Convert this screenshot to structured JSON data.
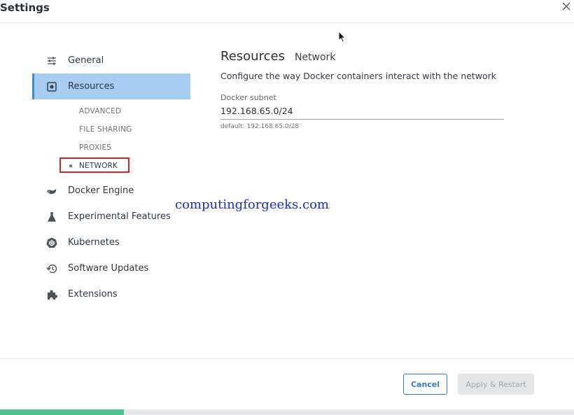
{
  "window": {
    "title": "Settings"
  },
  "sidebar": {
    "items": [
      {
        "label": "General",
        "icon": "sliders-icon"
      },
      {
        "label": "Resources",
        "icon": "resources-icon",
        "active": true
      },
      {
        "label": "Docker Engine",
        "icon": "whale-icon"
      },
      {
        "label": "Experimental Features",
        "icon": "flask-icon"
      },
      {
        "label": "Kubernetes",
        "icon": "helm-wheel-icon"
      },
      {
        "label": "Software Updates",
        "icon": "history-icon"
      },
      {
        "label": "Extensions",
        "icon": "puzzle-icon"
      }
    ],
    "resources_sub": [
      {
        "label": "ADVANCED"
      },
      {
        "label": "FILE SHARING"
      },
      {
        "label": "PROXIES"
      },
      {
        "label": "NETWORK",
        "current": true
      }
    ]
  },
  "content": {
    "title": "Resources",
    "subtitle": "Network",
    "description": "Configure the way Docker containers interact with the network",
    "subnet": {
      "label": "Docker subnet",
      "value": "192.168.65.0/24",
      "hint": "default: 192.168.65.0/28"
    }
  },
  "watermark": "computingforgeeks.com",
  "footer": {
    "cancel_label": "Cancel",
    "apply_label": "Apply & Restart"
  },
  "colors": {
    "active_bg": "#a8cdf2",
    "accent": "#2f7fc7",
    "highlight": "#e02020",
    "progress": "#4fc48c"
  }
}
